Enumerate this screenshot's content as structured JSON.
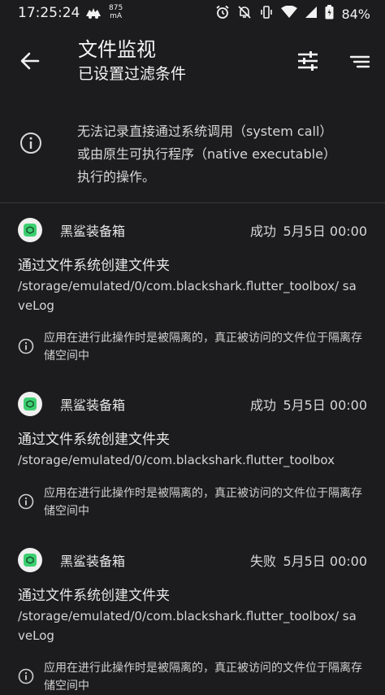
{
  "status_bar": {
    "time": "17:25:24",
    "speed_value": "875",
    "speed_unit": "mA",
    "battery_percent": "84%"
  },
  "header": {
    "title": "文件监视",
    "subtitle": "已设置过滤条件"
  },
  "notice": {
    "text": "无法记录直接通过系统调用（system call）或由原生可执行程序（native executable）执行的操作。"
  },
  "records": [
    {
      "app": "黑鲨装备箱",
      "status": "成功",
      "time": "5月5日 00:00",
      "operation": "通过文件系统创建文件夹",
      "path": "/storage/emulated/0/com.blackshark.flutter_toolbox/ saveLog",
      "isolation_note": "应用在进行此操作时是被隔离的，真正被访问的文件位于隔离存储空间中"
    },
    {
      "app": "黑鲨装备箱",
      "status": "成功",
      "time": "5月5日 00:00",
      "operation": "通过文件系统创建文件夹",
      "path": "/storage/emulated/0/com.blackshark.flutter_toolbox",
      "isolation_note": "应用在进行此操作时是被隔离的，真正被访问的文件位于隔离存储空间中"
    },
    {
      "app": "黑鲨装备箱",
      "status": "失败",
      "time": "5月5日 00:00",
      "operation": "通过文件系统创建文件夹",
      "path": "/storage/emulated/0/com.blackshark.flutter_toolbox/ saveLog",
      "isolation_note": "应用在进行此操作时是被隔离的，真正被访问的文件位于隔离存储空间中"
    }
  ],
  "icons": {
    "back": "arrow-back-icon",
    "filter": "tune-icon",
    "sort": "sort-icon",
    "info": "info-icon",
    "app": "shark-app-icon"
  },
  "colors": {
    "background": "#1c1c1e",
    "app_icon_accent": "#3ccf71"
  }
}
